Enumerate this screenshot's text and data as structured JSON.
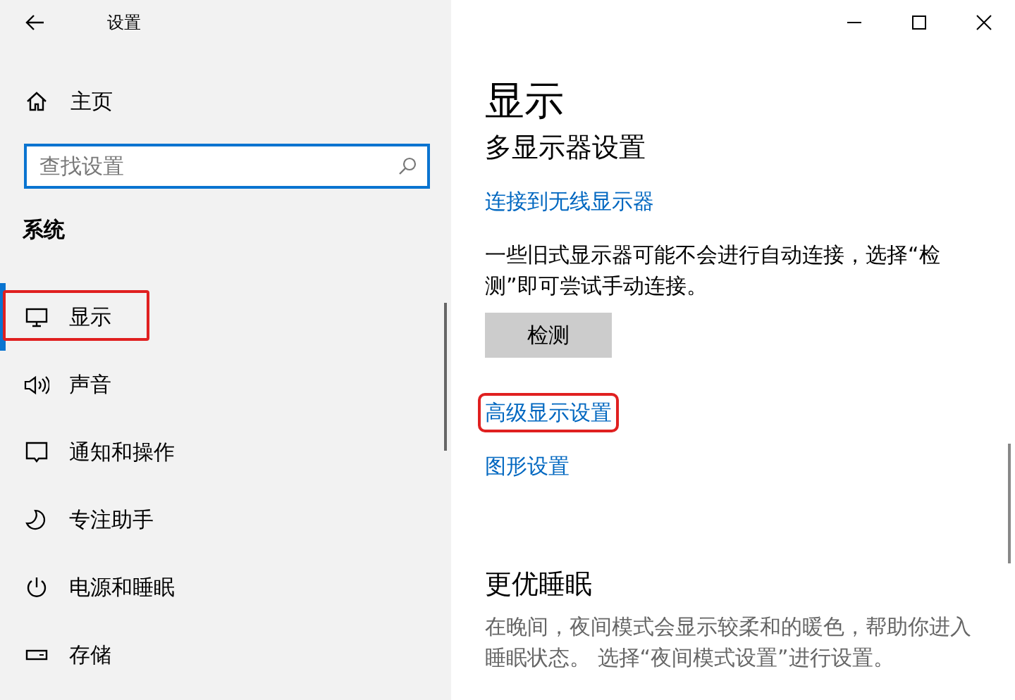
{
  "window": {
    "title": "设置"
  },
  "sidebar": {
    "home": "主页",
    "search": {
      "placeholder": "查找设置"
    },
    "section": "系统",
    "items": [
      {
        "label": "显示",
        "selected": true,
        "highlighted": true
      },
      {
        "label": "声音",
        "selected": false,
        "highlighted": false
      },
      {
        "label": "通知和操作",
        "selected": false,
        "highlighted": false
      },
      {
        "label": "专注助手",
        "selected": false,
        "highlighted": false
      },
      {
        "label": "电源和睡眠",
        "selected": false,
        "highlighted": false
      },
      {
        "label": "存储",
        "selected": false,
        "highlighted": false
      }
    ]
  },
  "content": {
    "title": "显示",
    "subtitle": "多显示器设置",
    "wireless_link": {
      "label": "连接到无线显示器",
      "highlighted": false
    },
    "description": "一些旧式显示器可能不会进行自动连接，选择“检测”即可尝试手动连接。",
    "detect_button": "检测",
    "links": [
      {
        "label": "高级显示设置",
        "highlighted": true
      },
      {
        "label": "图形设置",
        "highlighted": false
      }
    ],
    "sleep_heading": "更优睡眠",
    "sleep_text": "在晚间，夜间模式会显示较柔和的暖色，帮助你进入睡眠状态。 选择“夜间模式设置”进行设置。"
  }
}
